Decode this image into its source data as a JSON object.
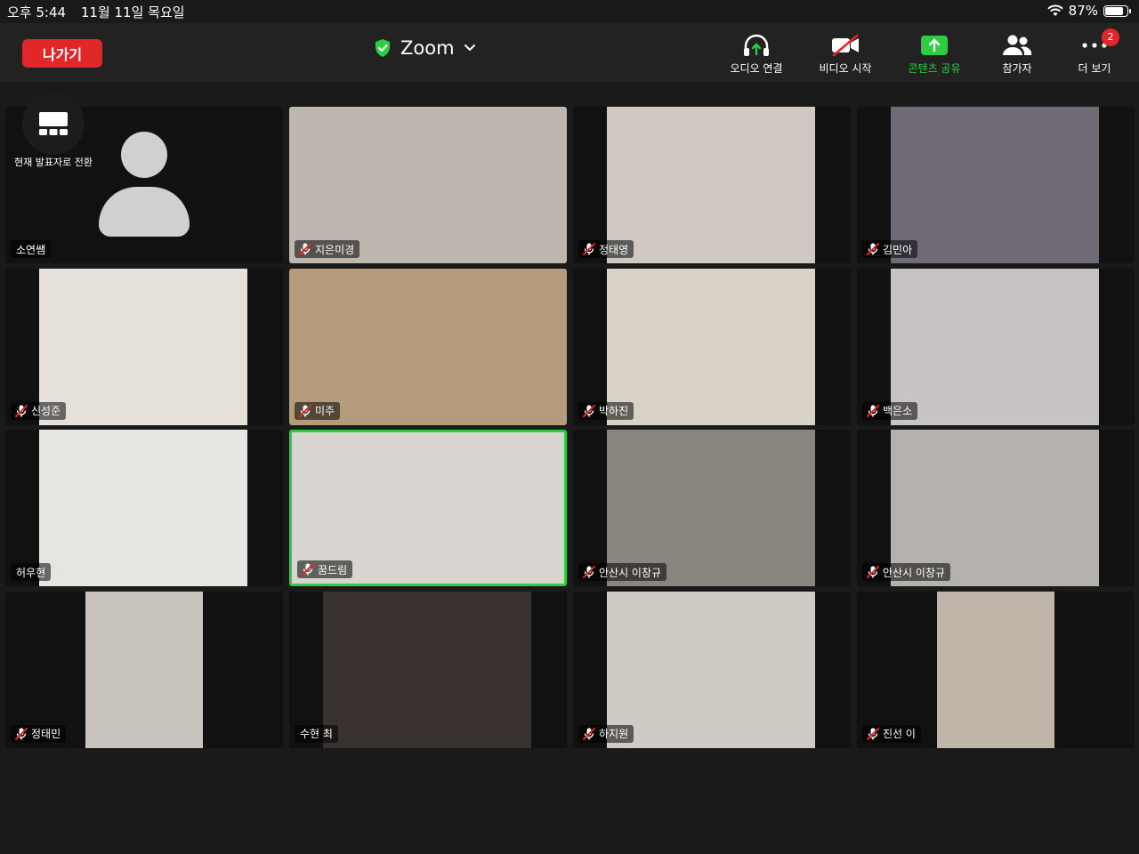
{
  "status_bar": {
    "time": "오후 5:44",
    "date": "11월 11일 목요일",
    "battery": "87%",
    "battery_level": 0.87
  },
  "header": {
    "leave_label": "나가기",
    "title": "Zoom",
    "shield_color": "#2ecc40"
  },
  "toolbar": {
    "audio_label": "오디오 연결",
    "video_label": "비디오 시작",
    "share_label": "콘텐츠 공유",
    "participants_label": "참가자",
    "more_label": "더 보기",
    "more_badge": "2"
  },
  "switch_speaker_label": "현재 발표자로 전환",
  "tiles": [
    {
      "name": "소연쌤",
      "muted": false,
      "video": false
    },
    {
      "name": "지은미경",
      "muted": true,
      "video": true,
      "bg": "#bdb7b0"
    },
    {
      "name": "정태영",
      "muted": true,
      "video": true,
      "bg": "#cfc9c2"
    },
    {
      "name": "김민아",
      "muted": true,
      "video": true,
      "bg": "#6f6a73"
    },
    {
      "name": "신성준",
      "muted": true,
      "video": true,
      "bg": "#e6e1da"
    },
    {
      "name": "미주",
      "muted": true,
      "video": true,
      "bg": "#b39b7b"
    },
    {
      "name": "박하진",
      "muted": true,
      "video": true,
      "bg": "#d9d2c6"
    },
    {
      "name": "백은소",
      "muted": true,
      "video": true,
      "bg": "#c8c3c5"
    },
    {
      "name": "허우현",
      "muted": false,
      "video": true,
      "bg": "#e7e5e1"
    },
    {
      "name": "꿈드림",
      "muted": true,
      "video": true,
      "bg": "#d8d4cf",
      "active": true
    },
    {
      "name": "안산시 이창규",
      "muted": true,
      "video": true,
      "bg": "#8b8580"
    },
    {
      "name": "안산시 이창규",
      "muted": true,
      "video": true,
      "bg": "#b5b2ae"
    },
    {
      "name": "정태민",
      "muted": true,
      "video": true,
      "bg": "#c9c4bd"
    },
    {
      "name": "수현 최",
      "muted": false,
      "video": true,
      "bg": "#3a3230"
    },
    {
      "name": "하지원",
      "muted": true,
      "video": true,
      "bg": "#cfcac4"
    },
    {
      "name": "진선 이",
      "muted": true,
      "video": true,
      "bg": "#bfb6a9"
    }
  ]
}
